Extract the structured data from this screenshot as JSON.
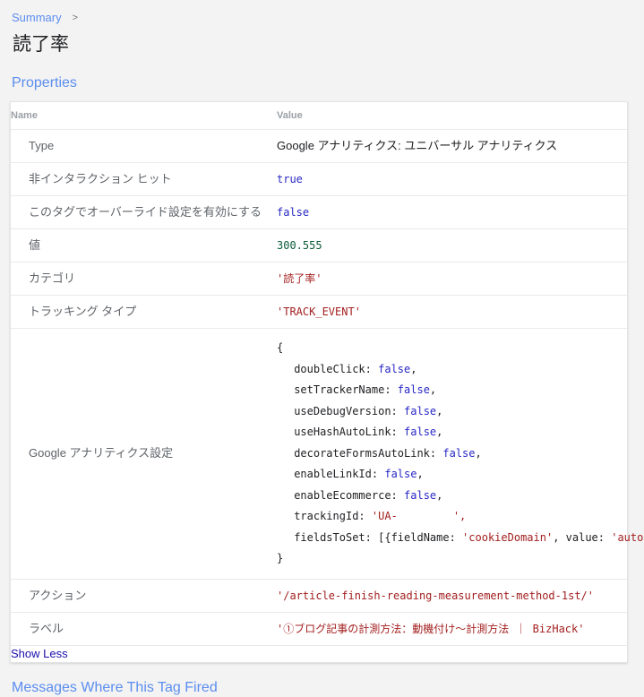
{
  "breadcrumb": {
    "link_label": "Summary",
    "separator": ">"
  },
  "page_title": "読了率",
  "sections": {
    "properties_heading": "Properties",
    "messages_link": "Messages Where This Tag Fired"
  },
  "table": {
    "headers": {
      "name": "Name",
      "value": "Value"
    },
    "rows": [
      {
        "name": "Type",
        "value": "Google アナリティクス: ユニバーサル アナリティクス",
        "kind": "plain"
      },
      {
        "name": "非インタラクション ヒット",
        "value": "true",
        "kind": "bool"
      },
      {
        "name": "このタグでオーバーライド設定を有効にする",
        "value": "false",
        "kind": "bool"
      },
      {
        "name": "値",
        "value": "300.555",
        "kind": "num"
      },
      {
        "name": "カテゴリ",
        "value": "'読了率'",
        "kind": "str"
      },
      {
        "name": "トラッキング タイプ",
        "value": "'TRACK_EVENT'",
        "kind": "str"
      }
    ],
    "settings_row": {
      "name": "Google アナリティクス設定",
      "code": {
        "open_brace": "{",
        "close_brace": "}",
        "entries": [
          {
            "key": "doubleClick:",
            "value": "false",
            "kind": "bool",
            "comma": ","
          },
          {
            "key": "setTrackerName:",
            "value": "false",
            "kind": "bool",
            "comma": ","
          },
          {
            "key": "useDebugVersion:",
            "value": "false",
            "kind": "bool",
            "comma": ","
          },
          {
            "key": "useHashAutoLink:",
            "value": "false",
            "kind": "bool",
            "comma": ","
          },
          {
            "key": "decorateFormsAutoLink:",
            "value": "false",
            "kind": "bool",
            "comma": ","
          },
          {
            "key": "enableLinkId:",
            "value": "false",
            "kind": "bool",
            "comma": ","
          },
          {
            "key": "enableEcommerce:",
            "value": "false",
            "kind": "bool",
            "comma": ","
          }
        ],
        "tracking_id": {
          "key": "trackingId:",
          "prefix": "'UA-",
          "redacted": "",
          "suffix": "',"
        },
        "fields_to_set": {
          "key": "fieldsToSet:",
          "open": "[{fieldName: ",
          "field_name": "'cookieDomain'",
          "mid": ", value: ",
          "field_value": "'auto'",
          "close": "}]"
        }
      }
    },
    "tail_rows": [
      {
        "name": "アクション",
        "value": "'/article-finish-reading-measurement-method-1st/'",
        "kind": "str"
      },
      {
        "name": "ラベル",
        "value": "'①ブログ記事の計測方法：動機付け〜計測方法 ｜ BizHack'",
        "kind": "str"
      }
    ],
    "show_less_label": "Show Less"
  },
  "colors": {
    "link": "#5b8def",
    "code_link": "#1a0dab",
    "bool": "#2727c4",
    "number": "#0a5c36",
    "string": "#a32020",
    "background": "#f3f3f3"
  }
}
